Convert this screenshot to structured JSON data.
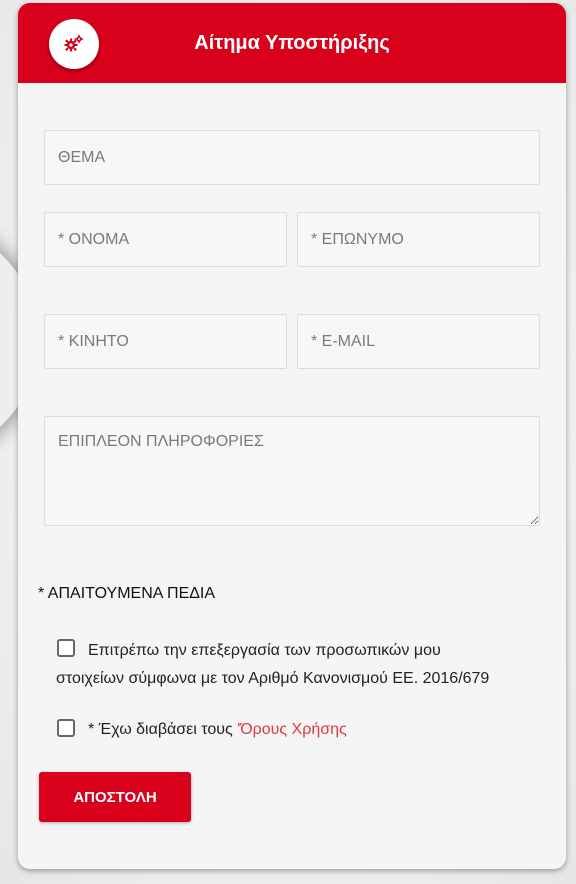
{
  "header": {
    "title": "Αίτημα Υποστήριξης",
    "icon": "gears-icon",
    "color": "#d9001b"
  },
  "form": {
    "subject_placeholder": "ΘΕΜΑ",
    "first_name_placeholder": "* ΟΝΟΜΑ",
    "last_name_placeholder": "* ΕΠΩΝΥΜΟ",
    "mobile_placeholder": "* ΚΙΝΗΤΟ",
    "email_placeholder": "* E-MAIL",
    "more_info_placeholder": "ΕΠΙΠΛΕΟΝ ΠΛΗΡΟΦΟΡΙΕΣ",
    "required_note": "* ΑΠΑΙΤΟΥΜΕΝΑ ΠΕΔΙΑ",
    "consent_line1": "Επιτρέπω την επεξεργασία των προσωπικών μου",
    "consent_line2": "στοιχείων σύμφωνα με τον Αριθμό Κανονισμού ΕΕ. 2016/679",
    "terms_prefix": "* Έχω διαβάσει τους ",
    "terms_link": "'Όρους Χρήσης",
    "submit_label": "ΑΠΟΣΤΟΛΗ",
    "link_color": "#e0393f"
  }
}
